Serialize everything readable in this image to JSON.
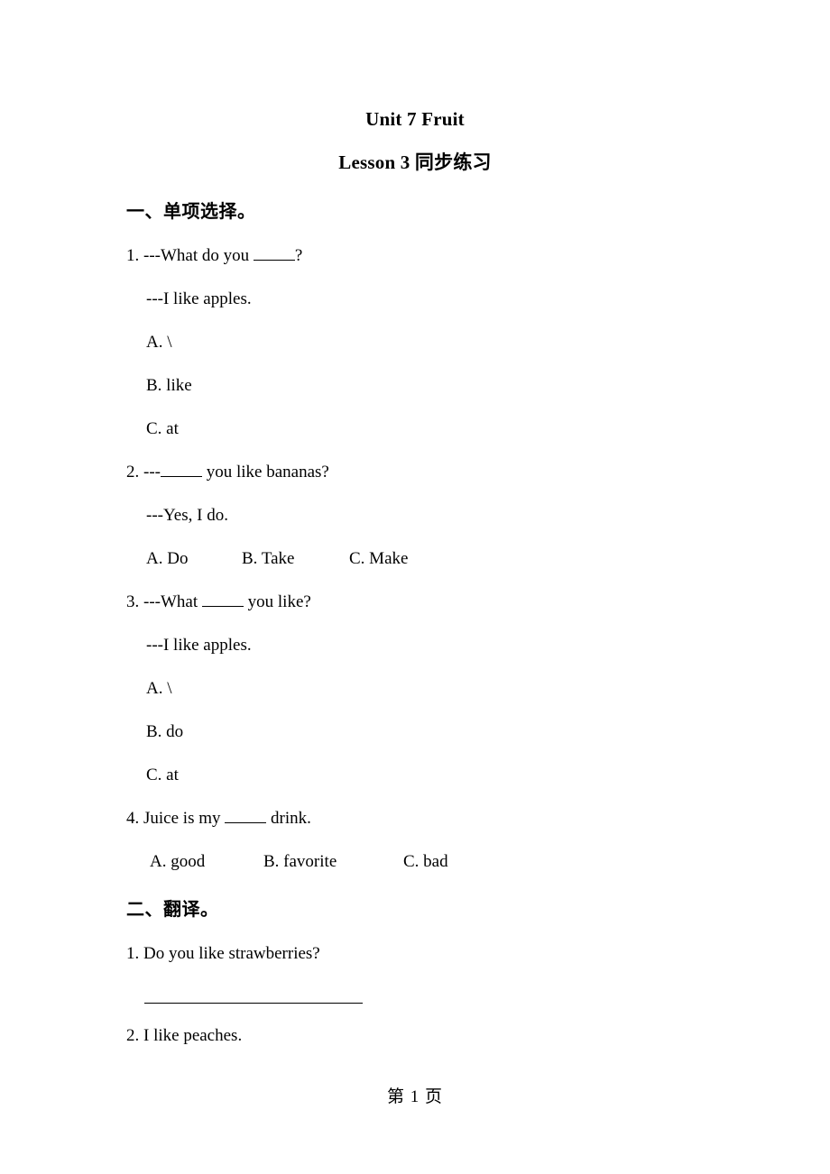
{
  "document": {
    "title": "Unit 7 Fruit",
    "subtitle": "Lesson 3 同步练习",
    "footer": "第 1 页"
  },
  "sections": [
    {
      "heading": "一、单项选择。",
      "questions": [
        {
          "stem_before": "1. ---What do you ",
          "stem_after": "?",
          "reply": "---I like apples.",
          "options_layout": "stacked",
          "options": [
            "A. \\",
            "B. like",
            "C. at"
          ]
        },
        {
          "stem_before": "2. ---",
          "stem_after": " you like bananas?",
          "reply": "---Yes, I do.",
          "options_layout": "inline",
          "options": [
            "A. Do",
            "B. Take",
            "C. Make"
          ]
        },
        {
          "stem_before": "3. ---What ",
          "stem_after": " you like?",
          "reply": "---I like apples.",
          "options_layout": "stacked",
          "options": [
            "A. \\",
            "B. do",
            "C. at"
          ]
        },
        {
          "stem_before": "4. Juice is my ",
          "stem_after": " drink.",
          "reply": "",
          "options_layout": "inline",
          "options": [
            "A. good",
            "B. favorite",
            "C. bad"
          ]
        }
      ]
    },
    {
      "heading": "二、翻译。",
      "items": [
        {
          "text": "1. Do you like strawberries?",
          "has_answer_line": true
        },
        {
          "text": "2. I like peaches.",
          "has_answer_line": false
        }
      ]
    }
  ]
}
